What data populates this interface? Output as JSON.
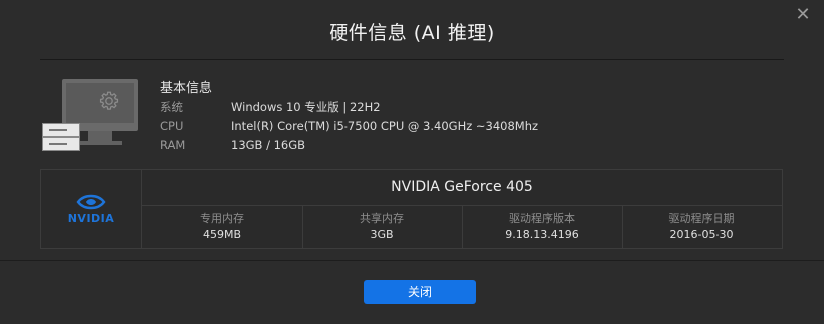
{
  "dialog": {
    "title": "硬件信息 (AI 推理)",
    "close_symbol": "✕"
  },
  "basic": {
    "heading": "基本信息",
    "rows": [
      {
        "label": "系统",
        "value": "Windows 10 专业版  |  22H2"
      },
      {
        "label": "CPU",
        "value": "Intel(R) Core(TM) i5-7500 CPU @ 3.40GHz ~3408Mhz"
      },
      {
        "label": "RAM",
        "value": "13GB / 16GB"
      }
    ]
  },
  "gpu": {
    "brand_text": "NVIDIA",
    "name": "NVIDIA GeForce 405",
    "cells": [
      {
        "label": "专用内存",
        "value": "459MB"
      },
      {
        "label": "共享内存",
        "value": "3GB"
      },
      {
        "label": "驱动程序版本",
        "value": "9.18.13.4196"
      },
      {
        "label": "驱动程序日期",
        "value": "2016-05-30"
      }
    ]
  },
  "footer": {
    "close_button": "关闭"
  },
  "colors": {
    "background": "#2c2c2c",
    "accent": "#1473e6",
    "nvidia_logo": "#1e74d9"
  }
}
